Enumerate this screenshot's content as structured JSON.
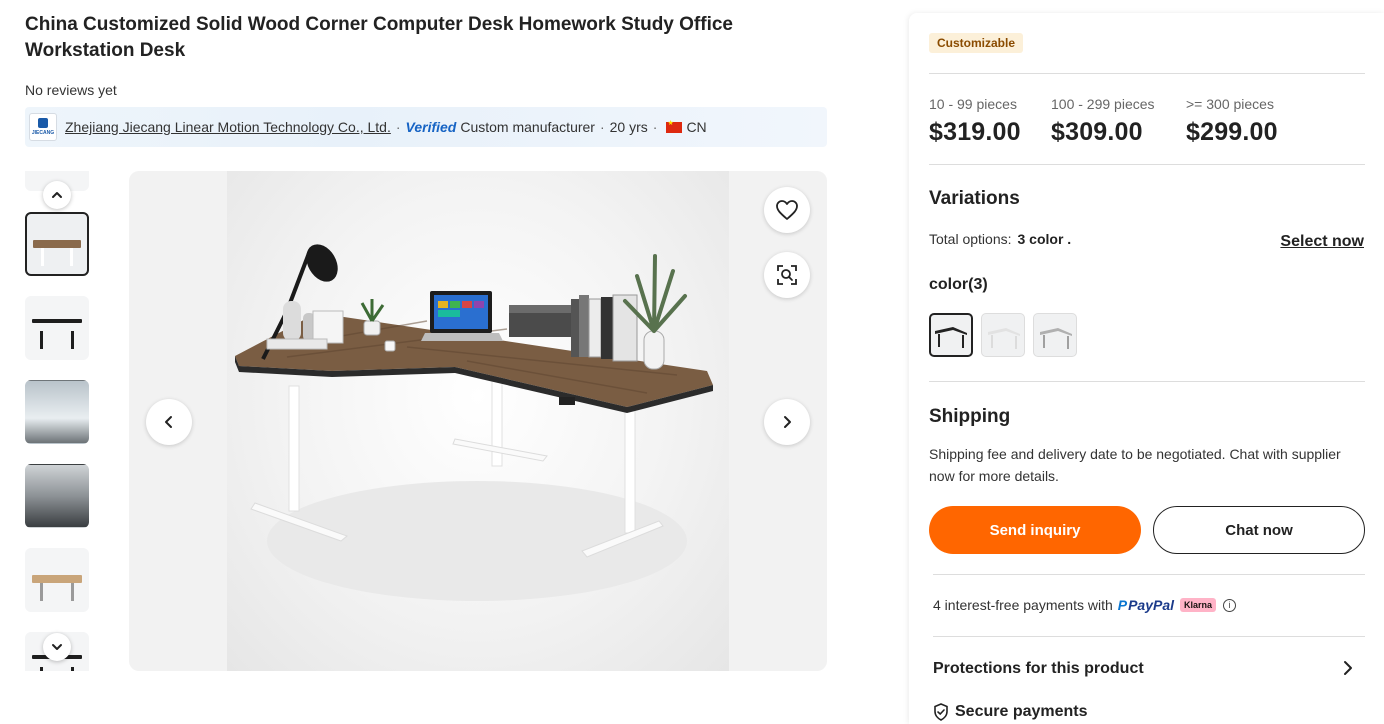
{
  "product": {
    "title": "China Customized Solid Wood Corner Computer Desk Homework Study Office Workstation Desk",
    "reviews": "No reviews yet"
  },
  "supplier": {
    "logo_text": "JIECANG",
    "name": "Zhejiang Jiecang Linear Motion Technology Co., Ltd.",
    "verified": "Verified",
    "type": "Custom manufacturer",
    "years": "20 yrs",
    "country": "CN"
  },
  "gallery": {
    "thumbnail_count": 7,
    "active_index": 1
  },
  "panel": {
    "badge": "Customizable",
    "tiers": [
      {
        "qty": "10 - 99 pieces",
        "price": "$319.00"
      },
      {
        "qty": "100 - 299 pieces",
        "price": "$309.00"
      },
      {
        "qty": ">= 300 pieces",
        "price": "$299.00"
      }
    ],
    "variations_title": "Variations",
    "total_options_label": "Total options:",
    "total_options_value": "3 color .",
    "select_now": "Select now",
    "color_label": "color(3)",
    "shipping_title": "Shipping",
    "shipping_text": "Shipping fee and delivery date to be negotiated. Chat with supplier now for more details.",
    "send_inquiry": "Send inquiry",
    "chat_now": "Chat now",
    "payments_text": "4 interest-free payments with",
    "paypal_text": "PayPal",
    "klarna_text": "Klarna",
    "protections": "Protections for this product",
    "secure_payments": "Secure payments"
  },
  "colors": {
    "accent": "#ff6600",
    "badge_bg": "#fcf0d9",
    "verified_blue": "#1764c4"
  },
  "icons": [
    "heart-icon",
    "image-search-icon",
    "chevron-left-icon",
    "chevron-right-icon",
    "chevron-up-icon",
    "chevron-down-icon",
    "info-icon",
    "shield-check-icon"
  ]
}
